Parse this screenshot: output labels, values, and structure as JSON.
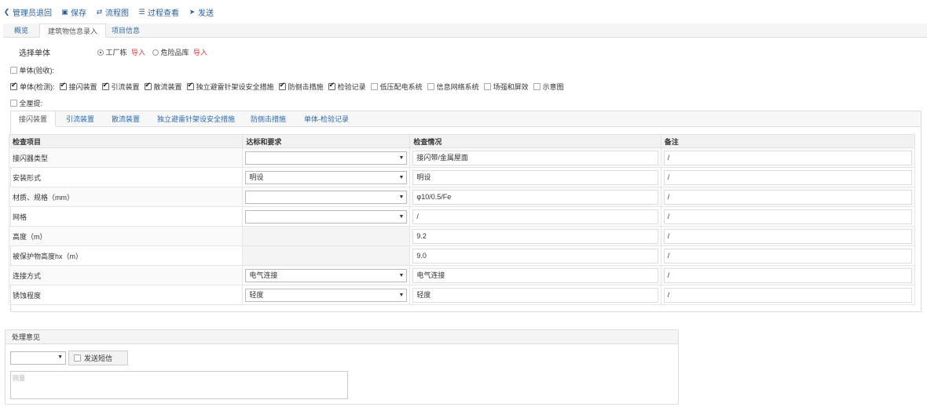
{
  "toolbar": {
    "back_label": "管理员退回",
    "save_label": "保存",
    "flow_label": "流程图",
    "process_label": "过程查看",
    "send_label": "发送"
  },
  "tabs": [
    "概览",
    "建筑物信息录入",
    "项目信息"
  ],
  "select_unit": {
    "label": "选择单体",
    "options": [
      {
        "label": "工厂栋",
        "import": "导入",
        "checked": true
      },
      {
        "label": "危险品库",
        "import": "导入",
        "checked": false
      }
    ]
  },
  "acceptance_label": "单体(验收):",
  "detect_items": [
    {
      "label": "单体(检测):",
      "checked": true
    },
    {
      "label": "接闪装置",
      "checked": true
    },
    {
      "label": "引流装置",
      "checked": true
    },
    {
      "label": "散流装置",
      "checked": true
    },
    {
      "label": "独立避雷针架设安全措施",
      "checked": true
    },
    {
      "label": "防侧击措施",
      "checked": true
    },
    {
      "label": "检验记录",
      "checked": true
    },
    {
      "label": "低压配电系统",
      "checked": false
    },
    {
      "label": "信息网络系统",
      "checked": false
    },
    {
      "label": "场强和屏效",
      "checked": false
    },
    {
      "label": "示意图",
      "checked": false
    }
  ],
  "whole_floor_label": "全厘提:",
  "subtabs": [
    "接闪装置",
    "引流装置",
    "散流装置",
    "独立避雷针架设安全措施",
    "防侧击措施",
    "单体-检验记录"
  ],
  "table": {
    "headers": [
      "检查项目",
      "达标和要求",
      "检查情况",
      "备注"
    ],
    "rows": [
      {
        "item": "接闪器类型",
        "select": "",
        "has_select": true,
        "status": "接闪带/金属屋面",
        "note": "/"
      },
      {
        "item": "安装形式",
        "select": "明设",
        "has_select": true,
        "status": "明设",
        "note": "/"
      },
      {
        "item": "材质、规格（mm）",
        "select": "",
        "has_select": true,
        "status": "φ10/0.5/Fe",
        "note": "/"
      },
      {
        "item": "网格",
        "select": "",
        "has_select": true,
        "status": "/",
        "note": "/"
      },
      {
        "item": "高度（m）",
        "select": "",
        "has_select": false,
        "status": "9.2",
        "note": "/"
      },
      {
        "item": "被保护物高度hx（m）",
        "select": "",
        "has_select": false,
        "status": "9.0",
        "note": "/"
      },
      {
        "item": "连接方式",
        "select": "电气连接",
        "has_select": true,
        "status": "电气连接",
        "note": "/"
      },
      {
        "item": "锈蚀程度",
        "select": "轻度",
        "has_select": true,
        "status": "轻度",
        "note": "/"
      }
    ]
  },
  "opinion": {
    "title": "处理意见",
    "sms_label": "发送短信",
    "comment": "同意"
  }
}
